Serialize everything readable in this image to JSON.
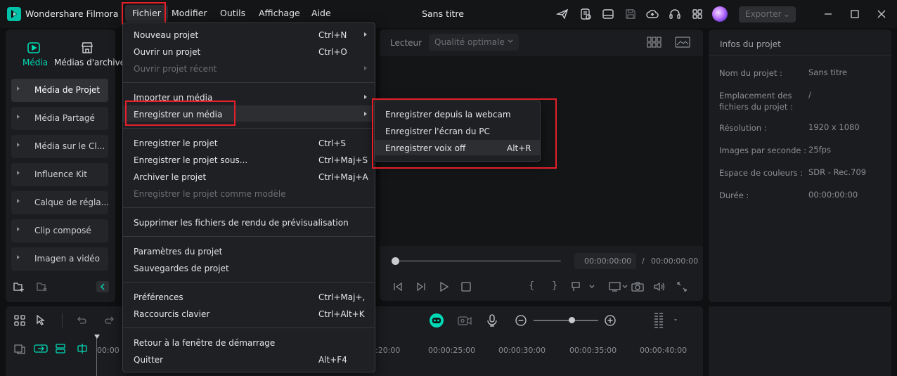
{
  "app": {
    "name": "Wondershare Filmora",
    "doc_title": "Sans titre"
  },
  "menubar": [
    "Fichier",
    "Modifier",
    "Outils",
    "Affichage",
    "Aide"
  ],
  "toolbar": {
    "export_label": "Exporter",
    "export_chevron": "⌄"
  },
  "media_tabs": [
    {
      "label": "Média",
      "icon": "media-icon"
    },
    {
      "label": "Médias d'archives",
      "icon": "store-icon"
    }
  ],
  "sidebar": [
    "Média de Projet",
    "Média Partagé",
    "Média sur le Cl...",
    "Influence Kit",
    "Calque de régla...",
    "Clip composé",
    "Imagen a vidéo"
  ],
  "player": {
    "lecteur": "Lecteur",
    "quality": "Qualité optimale",
    "current_time": "00:00:00:00",
    "separator": "/",
    "total_time": "00:00:00:00",
    "brace_open": "{",
    "brace_close": "}"
  },
  "info": {
    "title": "Infos du projet",
    "rows": [
      {
        "label": "Nom du projet :",
        "value": "Sans titre"
      },
      {
        "label": "Emplacement des fichiers du projet :",
        "value": "/"
      },
      {
        "label": "Résolution :",
        "value": "1920 x 1080"
      },
      {
        "label": "Images par seconde :",
        "value": "25fps"
      },
      {
        "label": "Espace de couleurs :",
        "value": "SDR - Rec.709"
      },
      {
        "label": "Durée :",
        "value": "00:00:00:00"
      }
    ]
  },
  "timeline": {
    "ruler": [
      "00:00",
      ":20:00",
      "00:00:25:00",
      "00:00:30:00",
      "00:00:35:00",
      "00:00:40:00"
    ]
  },
  "fichier_menu": {
    "nouveau": {
      "label": "Nouveau projet",
      "shortcut": "Ctrl+N"
    },
    "ouvrir": {
      "label": "Ouvrir un projet",
      "shortcut": "Ctrl+O"
    },
    "recent": {
      "label": "Ouvrir projet récent"
    },
    "importer": {
      "label": "Importer un média"
    },
    "enregistrer_media": {
      "label": "Enregistrer un média"
    },
    "enregistrer_projet": {
      "label": "Enregistrer le projet",
      "shortcut": "Ctrl+S"
    },
    "enregistrer_sous": {
      "label": "Enregistrer le projet sous...",
      "shortcut": "Ctrl+Maj+S"
    },
    "archiver": {
      "label": "Archiver le projet",
      "shortcut": "Ctrl+Maj+A"
    },
    "modele": {
      "label": "Enregistrer le projet comme modèle"
    },
    "supprimer": {
      "label": "Supprimer les fichiers de rendu de prévisualisation"
    },
    "parametres": {
      "label": "Paramètres du projet"
    },
    "sauvegardes": {
      "label": "Sauvegardes de projet"
    },
    "preferences": {
      "label": "Préférences",
      "shortcut": "Ctrl+Maj+,"
    },
    "raccourcis": {
      "label": "Raccourcis clavier",
      "shortcut": "Ctrl+Alt+K"
    },
    "retour": {
      "label": "Retour à la fenêtre de démarrage"
    },
    "quitter": {
      "label": "Quitter",
      "shortcut": "Alt+F4"
    }
  },
  "submenu": {
    "webcam": {
      "label": "Enregistrer depuis la webcam"
    },
    "ecran": {
      "label": "Enregistrer l'écran du PC"
    },
    "voix": {
      "label": "Enregistrer voix off",
      "shortcut": "Alt+R"
    }
  },
  "colors": {
    "accent": "#00d9b6",
    "highlight_box": "#e5202a",
    "panel": "#1b1c1f"
  }
}
